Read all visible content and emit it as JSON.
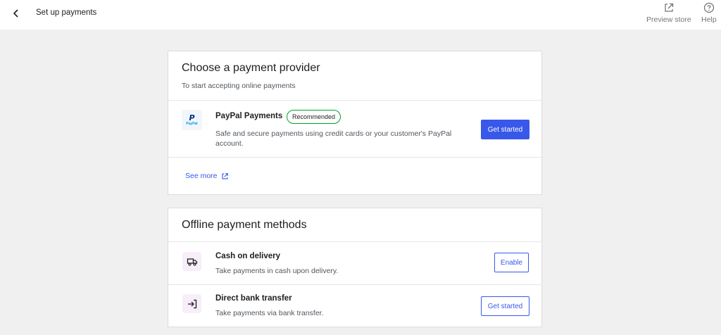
{
  "header": {
    "title": "Set up payments",
    "preview_label": "Preview store",
    "help_label": "Help"
  },
  "provider_section": {
    "title": "Choose a payment provider",
    "subtitle": "To start accepting online payments",
    "paypal": {
      "logo_letter": "P",
      "logo_word": "PayPal",
      "name": "PayPal Payments",
      "badge": "Recommended",
      "description_line1": "Safe and secure payments using credit cards or your customer's PayPal",
      "description_line2": "account.",
      "button_label": "Get started"
    },
    "see_more_label": "See more"
  },
  "offline_section": {
    "title": "Offline payment methods",
    "methods": [
      {
        "name": "Cash on delivery",
        "description": "Take payments in cash upon delivery.",
        "button_label": "Enable",
        "icon": "truck-icon"
      },
      {
        "name": "Direct bank transfer",
        "description": "Take payments via bank transfer.",
        "button_label": "Get started",
        "icon": "bank-transfer-icon"
      }
    ]
  },
  "colors": {
    "accent": "#3858e9",
    "badge_border": "#00a32a",
    "icon_tile_bg": "#f7eefa",
    "paypal_tile_bg": "#f2f6fc",
    "page_bg": "#f0f0f0"
  }
}
